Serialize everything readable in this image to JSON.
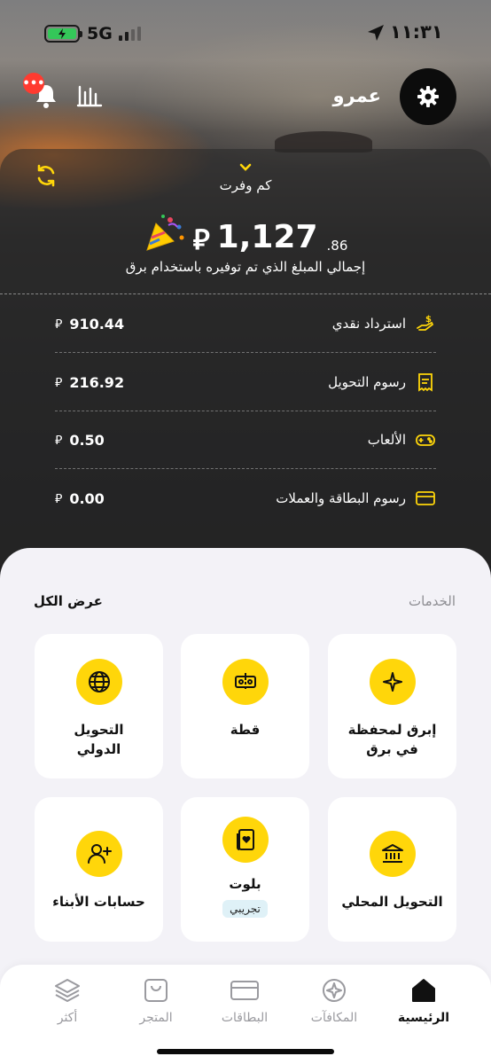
{
  "status_bar": {
    "time": "١١:٣١",
    "network": "5G",
    "battery_level": 1.0
  },
  "header": {
    "user_name": "عمرو",
    "notification_badge": "•••"
  },
  "savings": {
    "toggle_label": "كم وفرت",
    "total_integer": "1,127",
    "total_decimal": ".86",
    "currency_symbol": "⃁",
    "caption": "إجمالي المبلغ الذي تم توفيره باستخدام برق",
    "breakdown": [
      {
        "label": "استرداد نقدي",
        "amount": "910.44",
        "icon": "cashback-icon"
      },
      {
        "label": "رسوم التحويل",
        "amount": "216.92",
        "icon": "receipt-icon"
      },
      {
        "label": "الألعاب",
        "amount": "0.50",
        "icon": "gamepad-icon"
      },
      {
        "label": "رسوم البطاقة والعملات",
        "amount": "0.00",
        "icon": "card-icon"
      }
    ]
  },
  "services": {
    "title": "الخدمات",
    "view_all": "عرض الكل",
    "items": [
      {
        "label": "إبرق لمحفظة\nفي برق",
        "icon": "sparkle-icon"
      },
      {
        "label": "قطة",
        "icon": "split-icon"
      },
      {
        "label": "التحويل\nالدولي",
        "icon": "globe-icon"
      },
      {
        "label": "التحويل المحلي",
        "icon": "bank-icon"
      },
      {
        "label": "بلوت",
        "icon": "playing-card-icon",
        "badge": "تجريبي"
      },
      {
        "label": "حسابات الأبناء",
        "icon": "add-user-icon"
      }
    ]
  },
  "tabbar": {
    "items": [
      {
        "label": "الرئيسية",
        "icon": "home-icon",
        "active": true
      },
      {
        "label": "المكافآت",
        "icon": "compass-icon",
        "active": false
      },
      {
        "label": "البطاقات",
        "icon": "card-icon",
        "active": false
      },
      {
        "label": "المتجر",
        "icon": "bag-icon",
        "active": false
      },
      {
        "label": "أكثر",
        "icon": "layers-icon",
        "active": false
      }
    ]
  },
  "colors": {
    "accent_yellow": "#ffd60a",
    "sheet_bg": "#f3f2f7",
    "badge_bg": "#dff1f7",
    "notification_red": "#ff3b30"
  }
}
